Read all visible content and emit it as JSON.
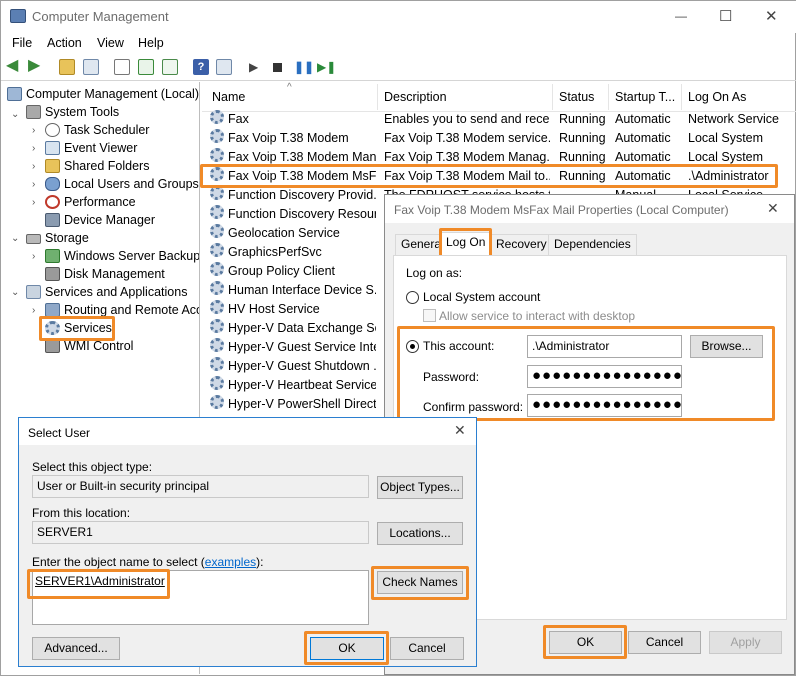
{
  "window": {
    "title": "Computer Management",
    "minimize": "—",
    "maximize": "☐",
    "close": "✕"
  },
  "menu": [
    "File",
    "Action",
    "View",
    "Help"
  ],
  "tree": {
    "root": "Computer Management (Local)",
    "system_tools": "System Tools",
    "task_scheduler": "Task Scheduler",
    "event_viewer": "Event Viewer",
    "shared_folders": "Shared Folders",
    "local_users": "Local Users and Groups",
    "performance": "Performance",
    "device_manager": "Device Manager",
    "storage": "Storage",
    "wsb": "Windows Server Backup",
    "disk_mgmt": "Disk Management",
    "services_apps": "Services and Applications",
    "routing": "Routing and Remote Acc",
    "services": "Services",
    "wmi": "WMI Control"
  },
  "list": {
    "columns": [
      "Name",
      "Description",
      "Status",
      "Startup T...",
      "Log On As"
    ],
    "rows": [
      {
        "name": "Fax",
        "desc": "Enables you to send and rece...",
        "status": "Running",
        "startup": "Automatic",
        "logon": "Network Service"
      },
      {
        "name": "Fax Voip T.38 Modem",
        "desc": "Fax Voip T.38 Modem service.",
        "status": "Running",
        "startup": "Automatic",
        "logon": "Local System"
      },
      {
        "name": "Fax Voip T.38 Modem Man...",
        "desc": "Fax Voip T.38 Modem Manag...",
        "status": "Running",
        "startup": "Automatic",
        "logon": "Local System"
      },
      {
        "name": "Fax Voip T.38 Modem MsF...",
        "desc": "Fax Voip T.38 Modem Mail to...",
        "status": "Running",
        "startup": "Automatic",
        "logon": ".\\Administrator"
      },
      {
        "name": "Function Discovery Provid...",
        "desc": "The FDPHOST service hosts t...",
        "status": "",
        "startup": "Manual",
        "logon": "Local Service"
      },
      {
        "name": "Function Discovery Resour...",
        "desc": "",
        "status": "",
        "startup": "",
        "logon": ""
      },
      {
        "name": "Geolocation Service",
        "desc": "",
        "status": "",
        "startup": "",
        "logon": ""
      },
      {
        "name": "GraphicsPerfSvc",
        "desc": "",
        "status": "",
        "startup": "",
        "logon": ""
      },
      {
        "name": "Group Policy Client",
        "desc": "",
        "status": "",
        "startup": "",
        "logon": ""
      },
      {
        "name": "Human Interface Device S...",
        "desc": "",
        "status": "",
        "startup": "",
        "logon": ""
      },
      {
        "name": "HV Host Service",
        "desc": "",
        "status": "",
        "startup": "",
        "logon": ""
      },
      {
        "name": "Hyper-V Data Exchange Se...",
        "desc": "",
        "status": "",
        "startup": "",
        "logon": ""
      },
      {
        "name": "Hyper-V Guest Service Inte...",
        "desc": "",
        "status": "",
        "startup": "",
        "logon": ""
      },
      {
        "name": "Hyper-V Guest Shutdown ...",
        "desc": "",
        "status": "",
        "startup": "",
        "logon": ""
      },
      {
        "name": "Hyper-V Heartbeat Service",
        "desc": "",
        "status": "",
        "startup": "",
        "logon": ""
      },
      {
        "name": "Hyper-V PowerShell Direct...",
        "desc": "",
        "status": "",
        "startup": "",
        "logon": ""
      }
    ]
  },
  "props": {
    "title": "Fax Voip T.38 Modem MsFax Mail Properties (Local Computer)",
    "tabs": [
      "General",
      "Log On",
      "Recovery",
      "Dependencies"
    ],
    "logon_as": "Log on as:",
    "local_system": "Local System account",
    "allow_interact": "Allow service to interact with desktop",
    "this_account": "This account:",
    "account_value": ".\\Administrator",
    "browse": "Browse...",
    "password": "Password:",
    "password_value": "●●●●●●●●●●●●●●●",
    "confirm": "Confirm password:",
    "confirm_value": "●●●●●●●●●●●●●●●",
    "ok": "OK",
    "cancel": "Cancel",
    "apply": "Apply"
  },
  "select_user": {
    "title": "Select User",
    "object_type_label": "Select this object type:",
    "object_type_value": "User or Built-in security principal",
    "object_types_btn": "Object Types...",
    "location_label": "From this location:",
    "location_value": "SERVER1",
    "locations_btn": "Locations...",
    "enter_label": "Enter the object name to select (",
    "examples": "examples",
    "enter_suffix": "):",
    "entered_value": "SERVER1\\Administrator",
    "check_names": "Check Names",
    "advanced": "Advanced...",
    "ok": "OK",
    "cancel": "Cancel"
  },
  "colors": {
    "highlight": "#f08a28",
    "dialog_title_blue": "#0078d7"
  }
}
